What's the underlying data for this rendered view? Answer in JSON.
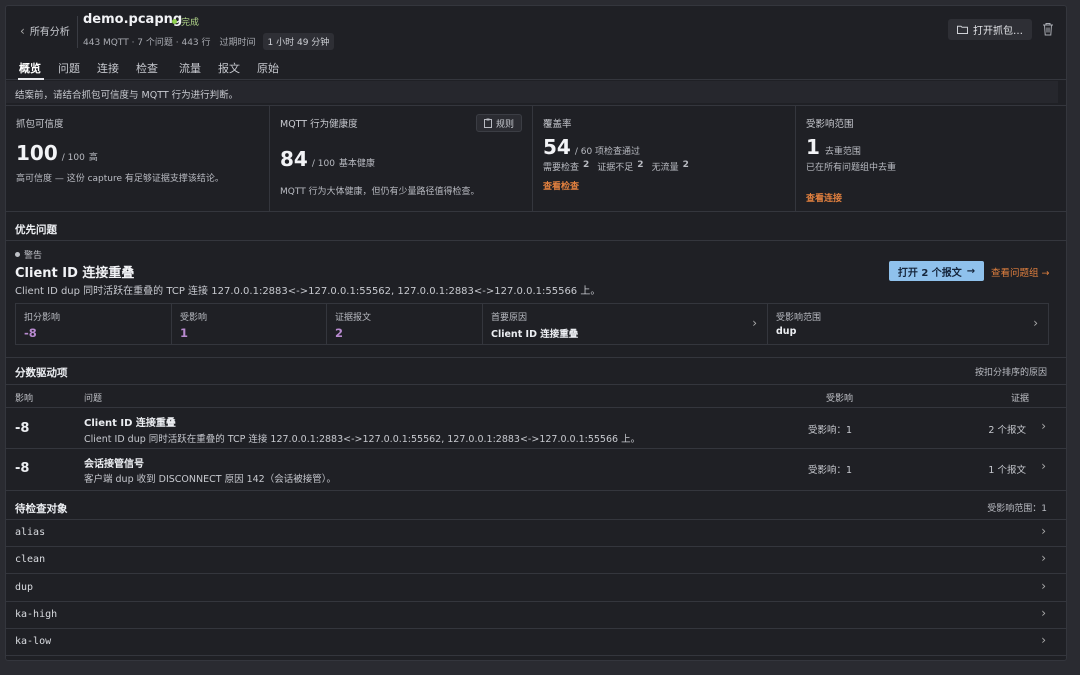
{
  "header": {
    "back_label": "所有分析",
    "file_name": "demo.pcapng",
    "status": "完成",
    "meta_counts": "443 MQTT · 7 个问题 · 443 行",
    "meta_duration_label": "过期时间",
    "meta_duration_value": "1 小时 49 分钟",
    "open_capture": "打开抓包…"
  },
  "tabs": [
    "概览",
    "问题",
    "连接",
    "检查",
    "流量",
    "报文",
    "原始"
  ],
  "banner": "结案前，请结合抓包可信度与 MQTT 行为进行判断。",
  "cards": {
    "confidence": {
      "title": "抓包可信度",
      "value": "100",
      "suffix": "/ 100",
      "grade": "高",
      "desc": "高可信度 — 这份 capture 有足够证据支撑该结论。"
    },
    "health": {
      "title": "MQTT 行为健康度",
      "rules": "规则",
      "value": "84",
      "suffix": "/ 100",
      "grade": "基本健康",
      "desc": "MQTT 行为大体健康，但仍有少量路径值得检查。"
    },
    "coverage": {
      "title": "覆盖率",
      "value": "54",
      "suffix": "/ 60 项检查通过",
      "detail_need_label": "需要检查",
      "detail_need": "2",
      "detail_insuff_label": "证据不足",
      "detail_insuff": "2",
      "detail_none_label": "无流量",
      "detail_none": "2",
      "link": "查看检查"
    },
    "scope": {
      "title": "受影响范围",
      "value": "1",
      "suffix": "去重范围",
      "desc": "已在所有问题组中去重",
      "link": "查看连接"
    }
  },
  "priority": {
    "section_title": "优先问题",
    "severity": "警告",
    "title": "Client ID 连接重叠",
    "desc": "Client ID dup 同时活跃在重叠的 TCP 连接 127.0.0.1:2883<->127.0.0.1:55562, 127.0.0.1:2883<->127.0.0.1:55566 上。",
    "open_btn": "打开 2 个报文",
    "view_group": "查看问题组",
    "stats": [
      {
        "label": "扣分影响",
        "value": "-8"
      },
      {
        "label": "受影响",
        "value": "1"
      },
      {
        "label": "证据报文",
        "value": "2"
      },
      {
        "label": "首要原因",
        "value": "Client ID 连接重叠"
      },
      {
        "label": "受影响范围",
        "value": "dup"
      }
    ]
  },
  "score": {
    "section_title": "分数驱动项",
    "section_right": "按扣分排序的原因",
    "headers": {
      "impact": "影响",
      "issue": "问题",
      "affected": "受影响",
      "evidence": "证据"
    },
    "rows": [
      {
        "impact": "-8",
        "title": "Client ID 连接重叠",
        "desc": "Client ID dup 同时活跃在重叠的 TCP 连接 127.0.0.1:2883<->127.0.0.1:55562, 127.0.0.1:2883<->127.0.0.1:55566 上。",
        "affected": "受影响：1",
        "evidence": "2 个报文"
      },
      {
        "impact": "-8",
        "title": "会话接管信号",
        "desc": "客户端 dup 收到 DISCONNECT 原因 142（会话被接管）。",
        "affected": "受影响：1",
        "evidence": "1 个报文"
      }
    ]
  },
  "pending": {
    "section_title": "待检查对象",
    "section_right": "受影响范围：1",
    "items": [
      "alias",
      "clean",
      "dup",
      "ka-high",
      "ka-low"
    ]
  },
  "colors": {
    "accent_blue": "#8fc1ec",
    "link_orange": "#e2803f",
    "status_green": "#8fd14f",
    "impact_purple": "#b88ad0"
  }
}
